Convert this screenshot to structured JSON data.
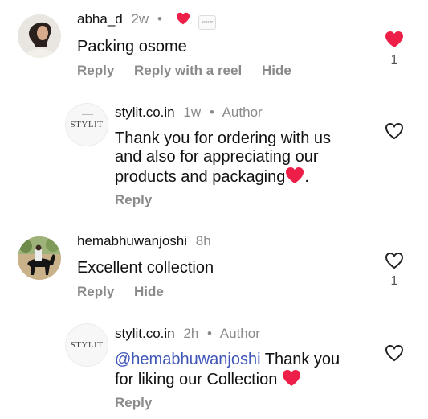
{
  "comments": [
    {
      "username": "abha_d",
      "time": "2w",
      "badge_text": "STYLIT",
      "text": "Packing osome",
      "actions": [
        "Reply",
        "Reply with a reel",
        "Hide"
      ],
      "liked": true,
      "like_count": "1"
    },
    {
      "username": "stylit.co.in",
      "time": "1w",
      "role": "Author",
      "avatar_text": "STYLIT",
      "text_lines": [
        "Thank you for ordering with us",
        "and also for appreciating our",
        "products and packaging"
      ],
      "text_end": ".",
      "actions": [
        "Reply"
      ],
      "liked": false
    },
    {
      "username": "hemabhuwanjoshi",
      "time": "8h",
      "text": "Excellent collection",
      "actions": [
        "Reply",
        "Hide"
      ],
      "liked": false,
      "like_count": "1"
    },
    {
      "username": "stylit.co.in",
      "time": "2h",
      "role": "Author",
      "avatar_text": "STYLIT",
      "mention": "@hemabhuwanjoshi",
      "text_after_mention": " Thank you",
      "text_line2": "for liking our Collection ",
      "actions": [
        "Reply"
      ],
      "liked": false
    }
  ],
  "colors": {
    "heart_red": "#ed1e47",
    "meta_gray": "#8a8a8a",
    "mention_blue": "#3f56b7"
  },
  "icons": {
    "like": "heart-icon",
    "emoji": "red-heart-emoji"
  }
}
